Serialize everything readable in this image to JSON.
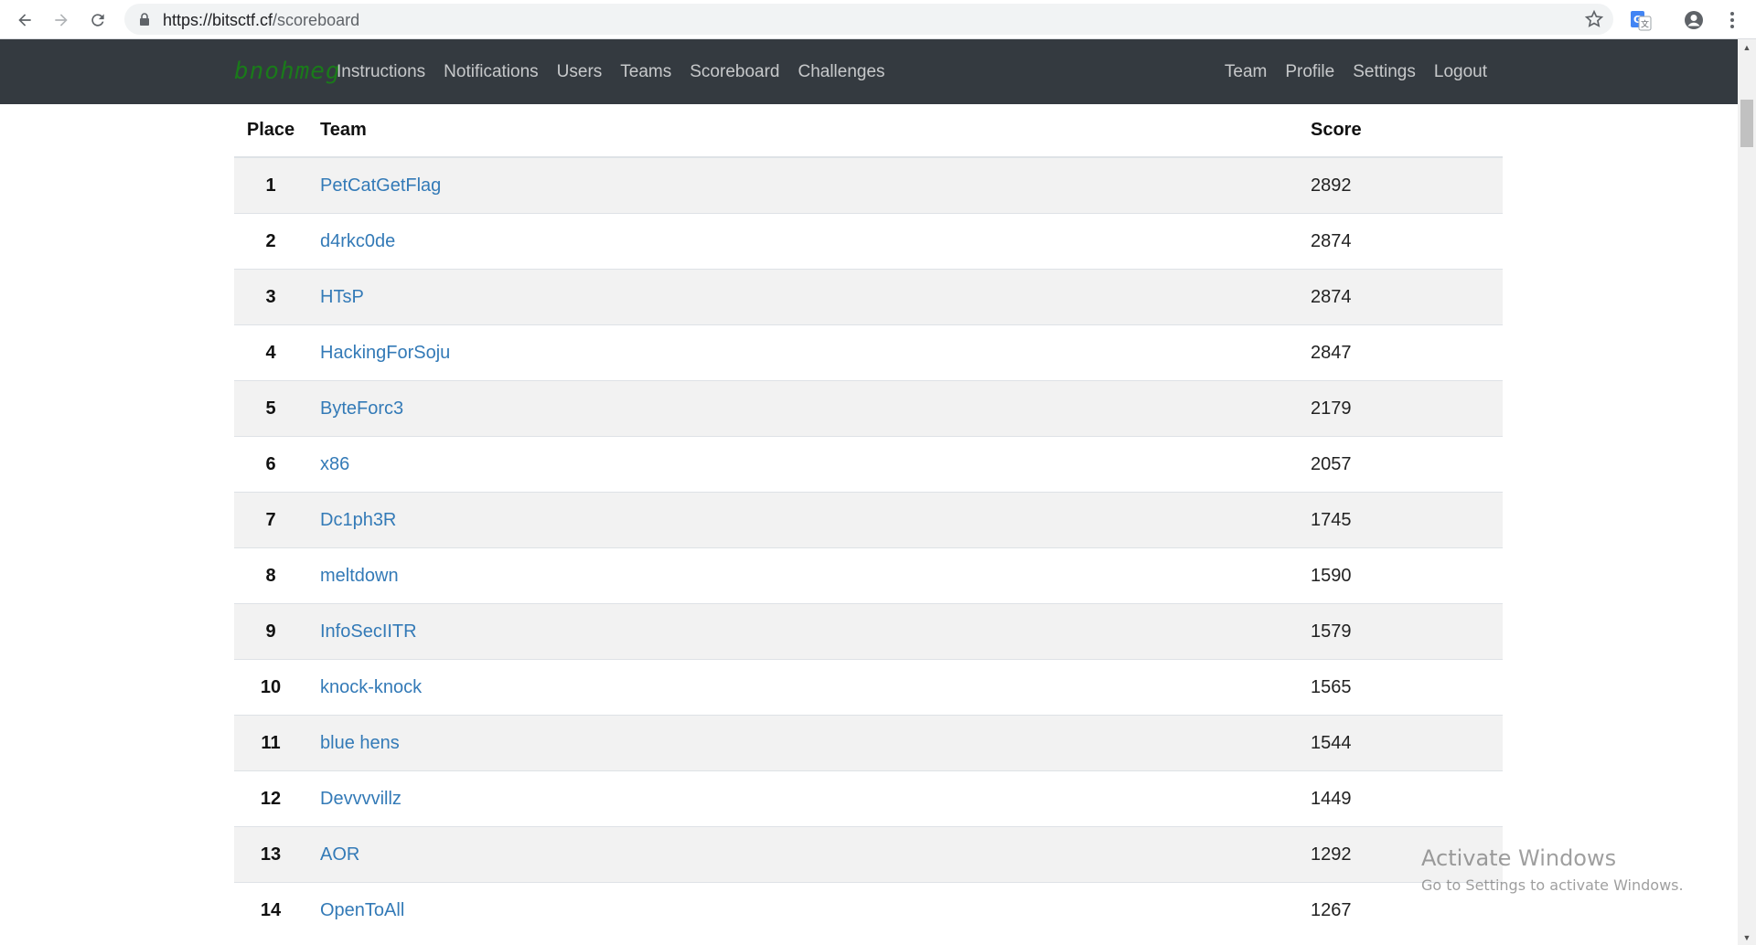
{
  "browser": {
    "url_host": "https://bitsctf.cf",
    "url_path": "/scoreboard",
    "icons": [
      "back-arrow-icon",
      "forward-arrow-icon",
      "reload-icon",
      "lock-icon",
      "star-icon",
      "translate-icon",
      "account-icon",
      "menu-dots-icon"
    ]
  },
  "navbar": {
    "brand": "bnohmeg",
    "left_links": [
      "Instructions",
      "Notifications",
      "Users",
      "Teams",
      "Scoreboard",
      "Challenges"
    ],
    "right_links": [
      "Team",
      "Profile",
      "Settings",
      "Logout"
    ],
    "background": "#343a40",
    "brand_color": "#1a7a1a"
  },
  "scoreboard": {
    "headers": {
      "place": "Place",
      "team": "Team",
      "score": "Score"
    },
    "rows": [
      {
        "place": "1",
        "team": "PetCatGetFlag",
        "score": "2892"
      },
      {
        "place": "2",
        "team": "d4rkc0de",
        "score": "2874"
      },
      {
        "place": "3",
        "team": "HTsP",
        "score": "2874"
      },
      {
        "place": "4",
        "team": "HackingForSoju",
        "score": "2847"
      },
      {
        "place": "5",
        "team": "ByteForc3",
        "score": "2179"
      },
      {
        "place": "6",
        "team": "x86",
        "score": "2057"
      },
      {
        "place": "7",
        "team": "Dc1ph3R",
        "score": "1745"
      },
      {
        "place": "8",
        "team": "meltdown",
        "score": "1590"
      },
      {
        "place": "9",
        "team": "InfoSecIITR",
        "score": "1579"
      },
      {
        "place": "10",
        "team": "knock-knock",
        "score": "1565"
      },
      {
        "place": "11",
        "team": "blue hens",
        "score": "1544"
      },
      {
        "place": "12",
        "team": "Devvvvillz",
        "score": "1449"
      },
      {
        "place": "13",
        "team": "AOR",
        "score": "1292"
      },
      {
        "place": "14",
        "team": "OpenToAll",
        "score": "1267"
      }
    ],
    "link_color": "#337ab7",
    "stripe_color": "#f2f2f2"
  },
  "watermark": {
    "title": "Activate Windows",
    "subtitle": "Go to Settings to activate Windows."
  }
}
